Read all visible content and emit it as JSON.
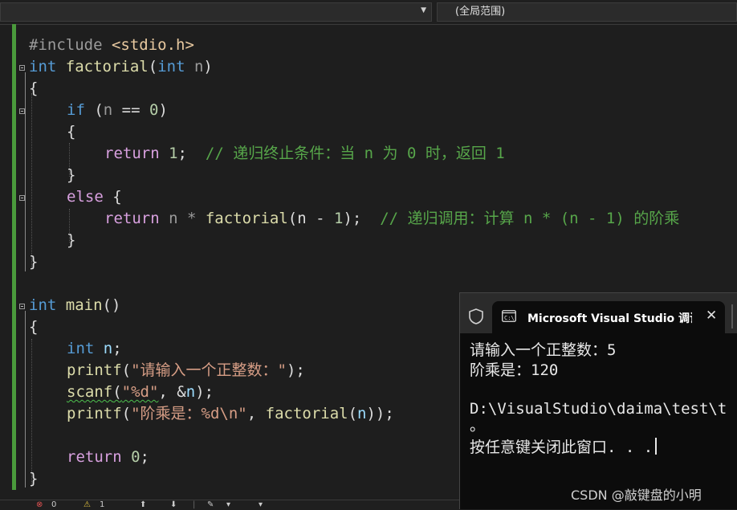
{
  "nav": {
    "scope": "(全局范围)"
  },
  "code": {
    "l1": {
      "pp": "#include ",
      "inc": "<stdio.h>"
    },
    "l2": {
      "kw1": "int",
      "fn": "factorial",
      "p1": "(",
      "kw2": "int",
      "param": "n",
      "p2": ")"
    },
    "l3": "{",
    "l4": {
      "kw": "if",
      "p1": " (",
      "var": "n",
      "op": " == ",
      "num": "0",
      "p2": ")"
    },
    "l5": "{",
    "l6": {
      "kw": "return",
      "sp": " ",
      "num": "1",
      "semi": ";  ",
      "cmt": "// 递归终止条件：当 n 为 0 时，返回 1"
    },
    "l7": "}",
    "l8": {
      "kw": "else",
      "rest": " {"
    },
    "l9": {
      "kw": "return",
      "a": " n * ",
      "fn": "factorial",
      "b": "(n - ",
      "num": "1",
      "c": ");  ",
      "cmt": "// 递归调用：计算 n * (n - 1) 的阶乘"
    },
    "l10": "}",
    "l11": "}",
    "l12": {
      "kw": "int",
      "fn": "main",
      "rest": "()"
    },
    "l13": "{",
    "l14": {
      "kw": "int",
      "sp": " ",
      "var": "n",
      "semi": ";"
    },
    "l15": {
      "fn": "printf",
      "p1": "(",
      "str": "\"请输入一个正整数：\"",
      "p2": ");"
    },
    "l16": {
      "fn": "scanf",
      "p1": "(",
      "str": "\"%d\"",
      "mid": ", &",
      "var": "n",
      "p2": ");"
    },
    "l17": {
      "fn": "printf",
      "p1": "(",
      "str": "\"阶乘是：%d\\n\"",
      "mid": ", ",
      "fn2": "factorial",
      "p2": "(",
      "var": "n",
      "p3": "));"
    },
    "l18": {
      "kw": "return",
      "sp": " ",
      "num": "0",
      "semi": ";"
    },
    "l19": "}"
  },
  "status": {
    "errors": "0",
    "warnings": "1"
  },
  "console": {
    "tab_title": "Microsoft Visual Studio 调试控制台",
    "close_glyph": "✕",
    "lines": [
      "请输入一个正整数：5",
      "阶乘是：120",
      "",
      "D:\\VisualStudio\\daima\\test\\t",
      "。",
      "按任意键关闭此窗口. . ."
    ],
    "watermark": "CSDN @敲键盘的小明"
  },
  "colors": {
    "keyword": "#569cd6",
    "function": "#dcdcaa",
    "comment": "#57a64a",
    "string": "#d69d85",
    "number": "#b5cea8",
    "variable": "#9cdcfe",
    "change_bar": "#4a9a3c"
  }
}
